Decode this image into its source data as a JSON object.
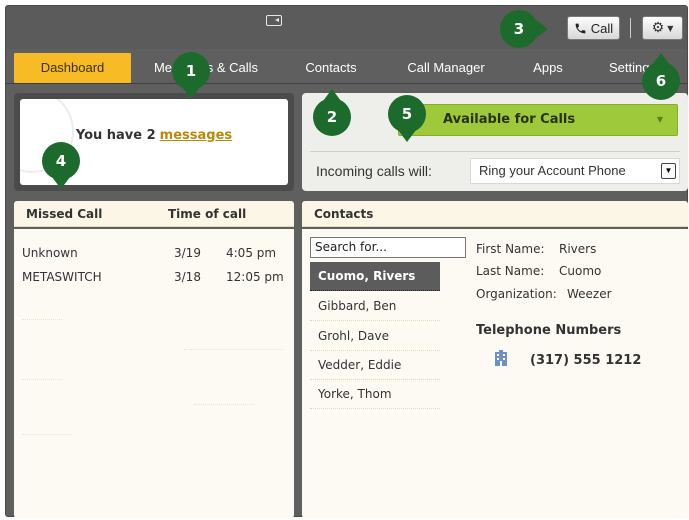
{
  "toolbar": {
    "camera_icon": "camera-icon",
    "call_label": "Call",
    "call_icon": "phone-icon",
    "gear_icon": "gear-icon"
  },
  "nav": {
    "tabs": [
      {
        "label": "Dashboard",
        "active": true
      },
      {
        "label": "Messages & Calls"
      },
      {
        "label": "Contacts"
      },
      {
        "label": "Call Manager"
      },
      {
        "label": "Apps"
      },
      {
        "label": "Settings"
      }
    ]
  },
  "messages": {
    "prefix": "You have 2",
    "link": "messages"
  },
  "availability": {
    "status": "Available for Calls",
    "incoming_label": "Incoming calls will:",
    "incoming_value": "Ring your Account Phone"
  },
  "missed_calls": {
    "header_missed": "Missed Call",
    "header_time": "Time of call",
    "rows": [
      {
        "name": "Unknown",
        "date": "3/19",
        "time": "4:05 pm"
      },
      {
        "name": "METASWITCH",
        "date": "3/18",
        "time": "12:05 pm"
      }
    ]
  },
  "contacts": {
    "header": "Contacts",
    "search_value": "Search for...",
    "list": [
      "Cuomo, Rivers",
      "Gibbard, Ben",
      "Grohl, Dave",
      "Vedder, Eddie",
      "Yorke, Thom"
    ],
    "detail": {
      "first_label": "First Name:",
      "first_value": "Rivers",
      "last_label": "Last Name:",
      "last_value": "Cuomo",
      "org_label": "Organization:",
      "org_value": "Weezer",
      "phones_header": "Telephone Numbers",
      "phone": "(317) 555 1212"
    }
  },
  "callouts": [
    "1",
    "2",
    "3",
    "4",
    "5",
    "6"
  ],
  "colors": {
    "active_tab": "#f6bb25",
    "available": "#9dc93b",
    "callout": "#1c6a2c",
    "link": "#b88a0c"
  }
}
